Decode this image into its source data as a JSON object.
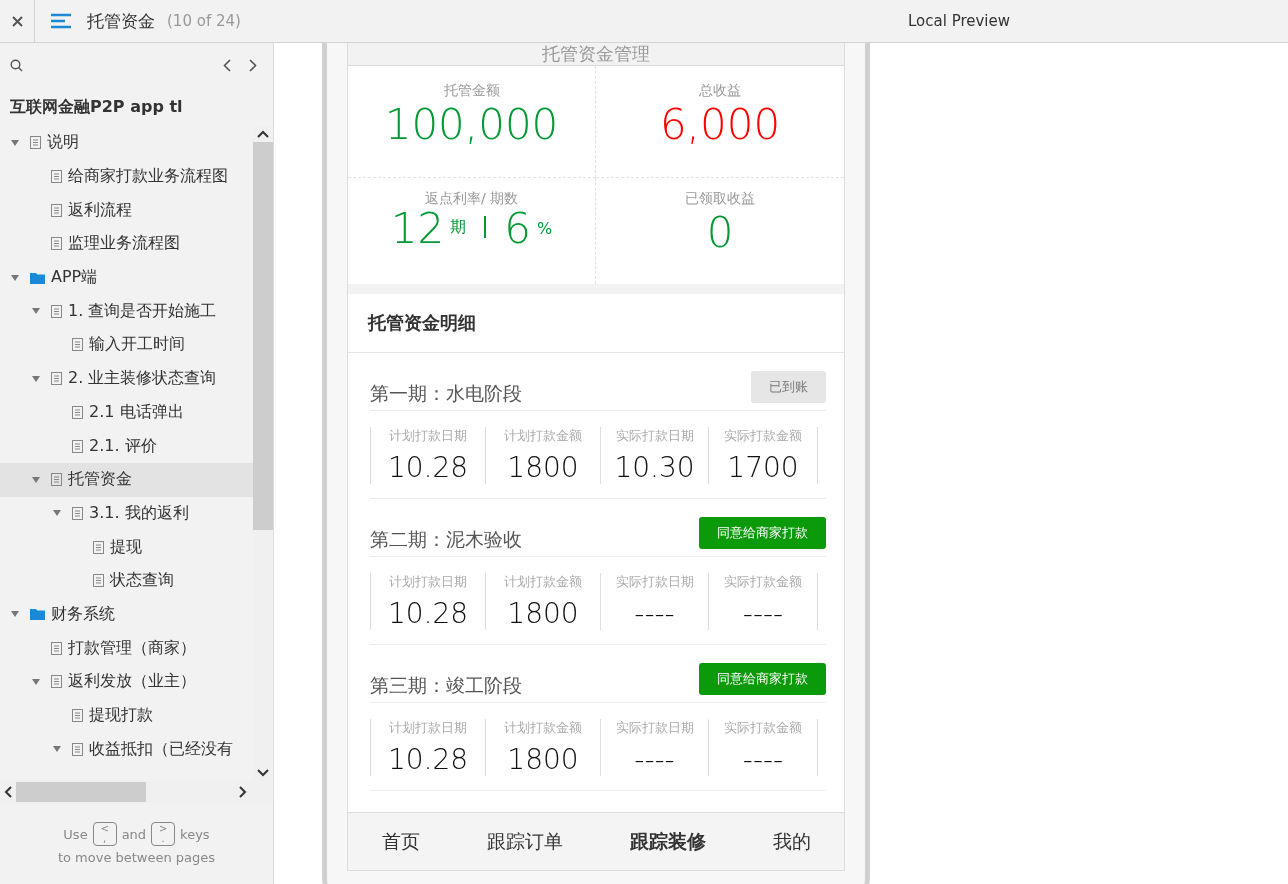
{
  "topbar": {
    "page_title": "托管资金",
    "page_count": "(10 of 24)",
    "preview_label": "Local Preview"
  },
  "sidebar": {
    "project_title": "互联网金融P2P app tl",
    "tree": [
      {
        "label": "说明",
        "kind": "page",
        "expanded": true,
        "selected": false,
        "children": [
          {
            "label": "给商家打款业务流程图",
            "kind": "page",
            "selected": false
          },
          {
            "label": "返利流程",
            "kind": "page",
            "selected": false
          },
          {
            "label": "监理业务流程图",
            "kind": "page",
            "selected": false
          }
        ]
      },
      {
        "label": "APP端",
        "kind": "folder",
        "expanded": true,
        "selected": false,
        "children": [
          {
            "label": "1. 查询是否开始施工",
            "kind": "page",
            "expanded": true,
            "selected": false,
            "children": [
              {
                "label": "输入开工时间",
                "kind": "page",
                "selected": false
              }
            ]
          },
          {
            "label": "2. 业主装修状态查询",
            "kind": "page",
            "expanded": true,
            "selected": false,
            "children": [
              {
                "label": "2.1 电话弹出",
                "kind": "page",
                "selected": false
              },
              {
                "label": "2.1. 评价",
                "kind": "page",
                "selected": false
              }
            ]
          },
          {
            "label": "托管资金",
            "kind": "page",
            "expanded": true,
            "selected": true,
            "children": [
              {
                "label": "3.1. 我的返利",
                "kind": "page",
                "expanded": true,
                "selected": false,
                "children": [
                  {
                    "label": "提现",
                    "kind": "page",
                    "selected": false
                  },
                  {
                    "label": "状态查询",
                    "kind": "page",
                    "selected": false
                  }
                ]
              }
            ]
          }
        ]
      },
      {
        "label": "财务系统",
        "kind": "folder",
        "expanded": true,
        "selected": false,
        "children": [
          {
            "label": "打款管理（商家）",
            "kind": "page",
            "selected": false
          },
          {
            "label": "返利发放（业主）",
            "kind": "page",
            "expanded": true,
            "selected": false,
            "children": [
              {
                "label": "提现打款",
                "kind": "page",
                "selected": false
              },
              {
                "label": "收益抵扣（已经没有",
                "kind": "page",
                "expanded": true,
                "selected": false
              }
            ]
          }
        ]
      }
    ],
    "hint": {
      "prefix": "Use",
      "key_1": [
        "<",
        ","
      ],
      "middle": "and",
      "key_2": [
        ">",
        "."
      ],
      "suffix": "keys",
      "line_2": "to move between pages"
    }
  },
  "phone": {
    "header_title": "托管资金管理",
    "summary": [
      {
        "label": "托管金额",
        "kind": "single",
        "value": "100,000",
        "color": "#009933"
      },
      {
        "label": "总收益",
        "kind": "single",
        "value": "6,000",
        "color": "#ff0000"
      },
      {
        "label": "返点利率/ 期数",
        "kind": "split",
        "parts": [
          {
            "value": "12",
            "unit": "期"
          },
          {
            "value": "6",
            "unit": "%"
          }
        ],
        "color": "#009933"
      },
      {
        "label": "已领取收益",
        "kind": "single",
        "value": "0",
        "color": "#009933"
      }
    ],
    "detail_title": "托管资金明细",
    "stages": [
      {
        "title": "第一期：水电阶段",
        "button": {
          "label": "已到账",
          "kind": "received"
        },
        "columns": [
          {
            "label": "计划打款日期",
            "value": "10.28"
          },
          {
            "label": "计划打款金额",
            "value": "1800"
          },
          {
            "label": "实际打款日期",
            "value": "10.30"
          },
          {
            "label": "实际打款金额",
            "value": "1700"
          }
        ]
      },
      {
        "title": "第二期：泥木验收",
        "button": {
          "label": "同意给商家打款",
          "kind": "action"
        },
        "columns": [
          {
            "label": "计划打款日期",
            "value": "10.28"
          },
          {
            "label": "计划打款金额",
            "value": "1800"
          },
          {
            "label": "实际打款日期",
            "value": "----"
          },
          {
            "label": "实际打款金额",
            "value": "----"
          }
        ]
      },
      {
        "title": "第三期：竣工阶段",
        "button": {
          "label": "同意给商家打款",
          "kind": "action"
        },
        "columns": [
          {
            "label": "计划打款日期",
            "value": "10.28"
          },
          {
            "label": "计划打款金额",
            "value": "1800"
          },
          {
            "label": "实际打款日期",
            "value": "----"
          },
          {
            "label": "实际打款金额",
            "value": "----"
          }
        ]
      }
    ],
    "tabs": [
      {
        "label": "首页",
        "selected": false
      },
      {
        "label": "跟踪订单",
        "selected": false
      },
      {
        "label": "跟踪装修",
        "selected": true
      },
      {
        "label": "我的",
        "selected": false
      }
    ]
  }
}
